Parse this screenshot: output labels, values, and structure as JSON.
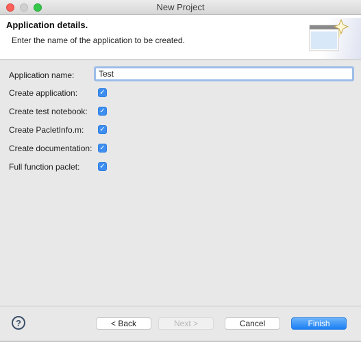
{
  "window": {
    "title": "New Project"
  },
  "header": {
    "title": "Application details.",
    "description": "Enter the name of the application to be created.",
    "icon": "new-window-wizard-icon"
  },
  "form": {
    "app_name_label": "Application name:",
    "app_name_value": "Test",
    "checkboxes": [
      {
        "label": "Create application:",
        "checked": true
      },
      {
        "label": "Create test notebook:",
        "checked": true
      },
      {
        "label": "Create PacletInfo.m:",
        "checked": true
      },
      {
        "label": "Create documentation:",
        "checked": true
      },
      {
        "label": "Full function paclet:",
        "checked": true
      }
    ],
    "check_glyph": "✓"
  },
  "footer": {
    "help_glyph": "?",
    "back_label": "< Back",
    "next_label": "Next >",
    "cancel_label": "Cancel",
    "finish_label": "Finish"
  },
  "colors": {
    "accent": "#3d8ef0",
    "focus_ring": "#9cbde9",
    "finish_top": "#6cb3fa",
    "finish_bottom": "#1b7ff4"
  }
}
